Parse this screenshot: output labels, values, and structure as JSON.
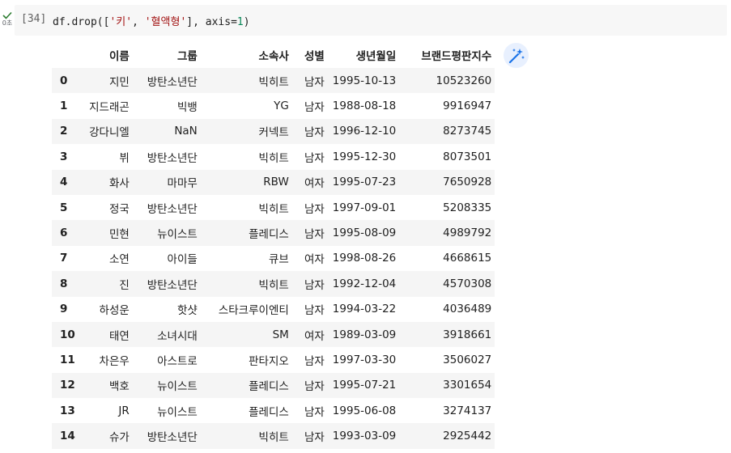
{
  "cell": {
    "exec_count": "[34]",
    "exec_time": "0초",
    "code": {
      "prefix": "df.drop([",
      "str1": "'키'",
      "sep": ", ",
      "str2": "'혈액형'",
      "mid": "], axis=",
      "num": "1",
      "suffix": ")"
    }
  },
  "table": {
    "columns": [
      "",
      "이름",
      "그룹",
      "소속사",
      "성별",
      "생년월일",
      "브랜드평판지수"
    ],
    "rows": [
      {
        "idx": "0",
        "name": "지민",
        "group": "방탄소년단",
        "agency": "빅히트",
        "sex": "남자",
        "birth": "1995-10-13",
        "index": "10523260"
      },
      {
        "idx": "1",
        "name": "지드래곤",
        "group": "빅뱅",
        "agency": "YG",
        "sex": "남자",
        "birth": "1988-08-18",
        "index": "9916947"
      },
      {
        "idx": "2",
        "name": "강다니엘",
        "group": "NaN",
        "agency": "커넥트",
        "sex": "남자",
        "birth": "1996-12-10",
        "index": "8273745"
      },
      {
        "idx": "3",
        "name": "뷔",
        "group": "방탄소년단",
        "agency": "빅히트",
        "sex": "남자",
        "birth": "1995-12-30",
        "index": "8073501"
      },
      {
        "idx": "4",
        "name": "화사",
        "group": "마마무",
        "agency": "RBW",
        "sex": "여자",
        "birth": "1995-07-23",
        "index": "7650928"
      },
      {
        "idx": "5",
        "name": "정국",
        "group": "방탄소년단",
        "agency": "빅히트",
        "sex": "남자",
        "birth": "1997-09-01",
        "index": "5208335"
      },
      {
        "idx": "6",
        "name": "민현",
        "group": "뉴이스트",
        "agency": "플레디스",
        "sex": "남자",
        "birth": "1995-08-09",
        "index": "4989792"
      },
      {
        "idx": "7",
        "name": "소연",
        "group": "아이들",
        "agency": "큐브",
        "sex": "여자",
        "birth": "1998-08-26",
        "index": "4668615"
      },
      {
        "idx": "8",
        "name": "진",
        "group": "방탄소년단",
        "agency": "빅히트",
        "sex": "남자",
        "birth": "1992-12-04",
        "index": "4570308"
      },
      {
        "idx": "9",
        "name": "하성운",
        "group": "핫샷",
        "agency": "스타크루이엔티",
        "sex": "남자",
        "birth": "1994-03-22",
        "index": "4036489"
      },
      {
        "idx": "10",
        "name": "태연",
        "group": "소녀시대",
        "agency": "SM",
        "sex": "여자",
        "birth": "1989-03-09",
        "index": "3918661"
      },
      {
        "idx": "11",
        "name": "차은우",
        "group": "아스트로",
        "agency": "판타지오",
        "sex": "남자",
        "birth": "1997-03-30",
        "index": "3506027"
      },
      {
        "idx": "12",
        "name": "백호",
        "group": "뉴이스트",
        "agency": "플레디스",
        "sex": "남자",
        "birth": "1995-07-21",
        "index": "3301654"
      },
      {
        "idx": "13",
        "name": "JR",
        "group": "뉴이스트",
        "agency": "플레디스",
        "sex": "남자",
        "birth": "1995-06-08",
        "index": "3274137"
      },
      {
        "idx": "14",
        "name": "슈가",
        "group": "방탄소년단",
        "agency": "빅히트",
        "sex": "남자",
        "birth": "1993-03-09",
        "index": "2925442"
      }
    ]
  },
  "icons": {
    "status": "check-icon",
    "magic": "magic-wand-icon"
  },
  "colors": {
    "check": "#2e7d32",
    "magic_bg": "#e8f0fe",
    "magic_fg": "#1a73e8",
    "string": "#a31515",
    "number": "#098658"
  }
}
